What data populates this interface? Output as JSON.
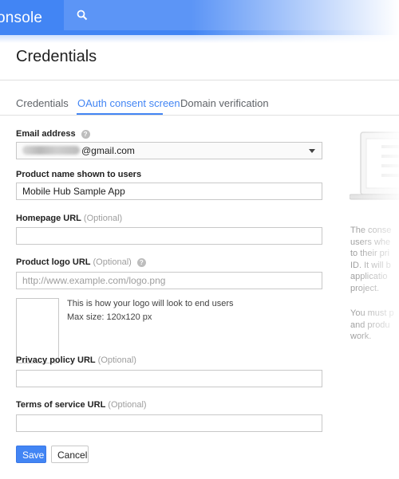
{
  "header": {
    "app_name": "onsole",
    "search_icon": "search-icon",
    "accent_color": "#4285f4"
  },
  "page": {
    "title": "Credentials"
  },
  "tabs": [
    {
      "label": "Credentials",
      "active": false
    },
    {
      "label": "OAuth consent screen",
      "active": true
    },
    {
      "label": "Domain verification",
      "active": false
    }
  ],
  "form": {
    "email": {
      "label": "Email address",
      "help_icon": "help-icon",
      "value_suffix": "@gmail.com",
      "value_obscured": true
    },
    "product_name": {
      "label": "Product name shown to users",
      "value": "Mobile Hub Sample App"
    },
    "homepage_url": {
      "label": "Homepage URL",
      "optional": "(Optional)",
      "value": ""
    },
    "product_logo_url": {
      "label": "Product logo URL",
      "optional": "(Optional)",
      "help_icon": "help-icon",
      "placeholder": "http://www.example.com/logo.png"
    },
    "logo_preview": {
      "hint": "This is how your logo will look to end users",
      "max_size": "Max size: 120x120 px"
    },
    "privacy_policy_url": {
      "label": "Privacy policy URL",
      "optional": "(Optional)",
      "value": ""
    },
    "terms_of_service_url": {
      "label": "Terms of service URL",
      "optional": "(Optional)",
      "value": ""
    }
  },
  "actions": {
    "save_label": "Save",
    "cancel_label": "Cancel"
  },
  "side_panel": {
    "illustration": "laptop-illustration",
    "lines_p1": [
      "The conse",
      "users whe",
      "to their pri",
      "ID. It will b",
      "applicatio",
      "project."
    ],
    "lines_p2": [
      "You must p",
      "and produ",
      "work."
    ]
  }
}
